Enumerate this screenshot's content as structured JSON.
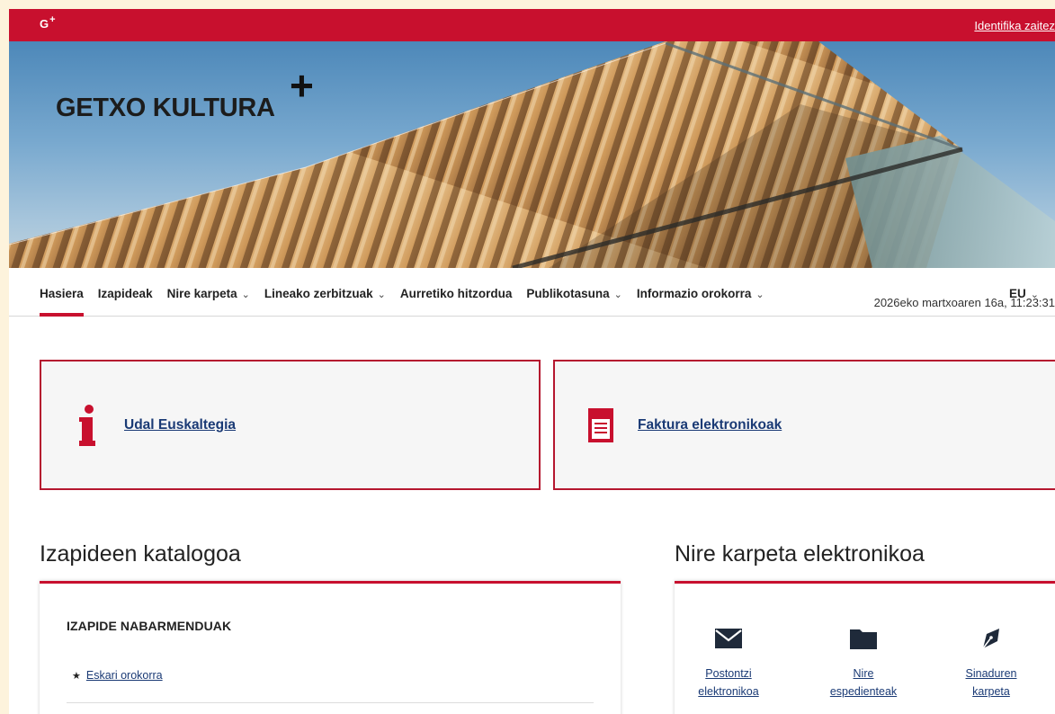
{
  "topbar": {
    "logo_text": "G",
    "logo_plus": "+",
    "login_label": "Identifika zaitez"
  },
  "hero": {
    "brand": "GETXO KULTURA",
    "brand_plus": "+"
  },
  "nav": {
    "items": [
      {
        "label": "Hasiera",
        "active": true,
        "dropdown": false
      },
      {
        "label": "Izapideak",
        "active": false,
        "dropdown": false
      },
      {
        "label": "Nire karpeta",
        "active": false,
        "dropdown": true
      },
      {
        "label": "Lineako zerbitzuak",
        "active": false,
        "dropdown": true
      },
      {
        "label": "Aurretiko hitzordua",
        "active": false,
        "dropdown": false
      },
      {
        "label": "Publikotasuna",
        "active": false,
        "dropdown": true
      },
      {
        "label": "Informazio orokorra",
        "active": false,
        "dropdown": true
      }
    ],
    "language": "EU",
    "chevron": "⌄"
  },
  "datetime": "2026eko martxoaren 16a, 11:23:31",
  "cards": [
    {
      "label": "Udal Euskaltegia",
      "icon": "info-icon"
    },
    {
      "label": "Faktura elektronikoak",
      "icon": "invoice-icon"
    }
  ],
  "catalog": {
    "title": "Izapideen katalogoa",
    "subtitle": "IZAPIDE NABARMENDUAK",
    "featured": [
      {
        "label": "Eskari orokorra",
        "icon": "star-icon"
      }
    ]
  },
  "folder": {
    "title": "Nire karpeta elektronikoa",
    "items": [
      {
        "line1": "Postontzi",
        "line2": "elektronikoa",
        "icon": "envelope-icon"
      },
      {
        "line1": "Nire",
        "line2": "espedienteak",
        "icon": "folder-icon"
      },
      {
        "line1": "Sinaduren",
        "line2": "karpeta",
        "icon": "pen-nib-icon"
      }
    ]
  },
  "colors": {
    "brand_red": "#c8102e",
    "link_blue": "#1a3a75",
    "background_outer": "#fdf3dc"
  }
}
